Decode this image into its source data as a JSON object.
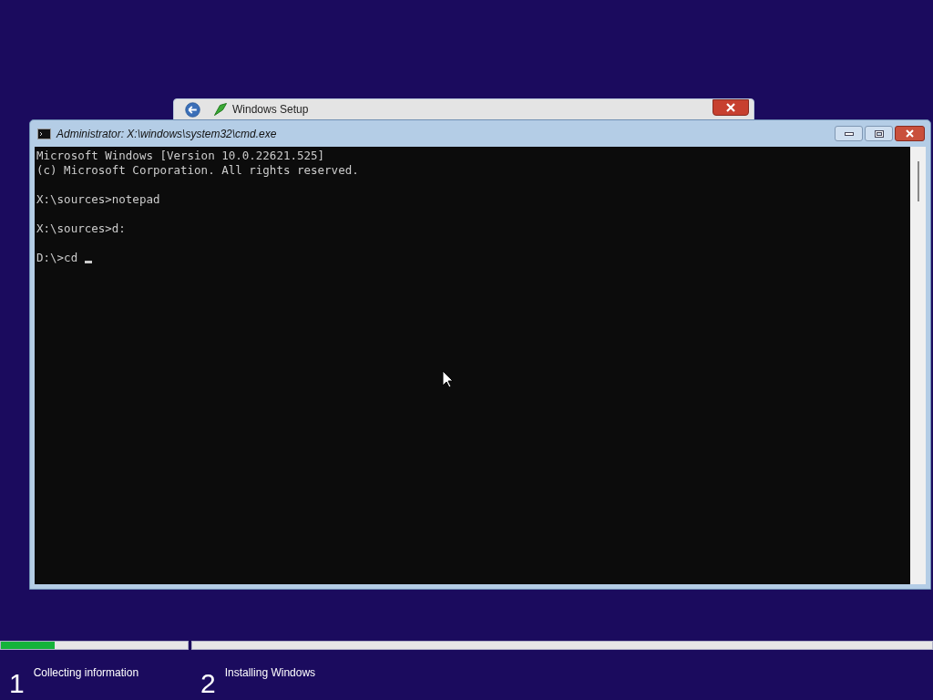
{
  "setup_window": {
    "title": "Windows Setup"
  },
  "console_window": {
    "title": "Administrator: X:\\windows\\system32\\cmd.exe",
    "blocks": [
      [
        "Microsoft Windows [Version 10.0.22621.525]",
        "(c) Microsoft Corporation. All rights reserved."
      ],
      [
        "X:\\sources>notepad"
      ],
      [
        "X:\\sources>d:"
      ],
      [
        "D:\\>cd "
      ]
    ],
    "cursor": true
  },
  "steps": [
    {
      "number": "1",
      "label": "Collecting information",
      "level": 0.29
    },
    {
      "number": "2",
      "label": "Installing Windows"
    }
  ]
}
